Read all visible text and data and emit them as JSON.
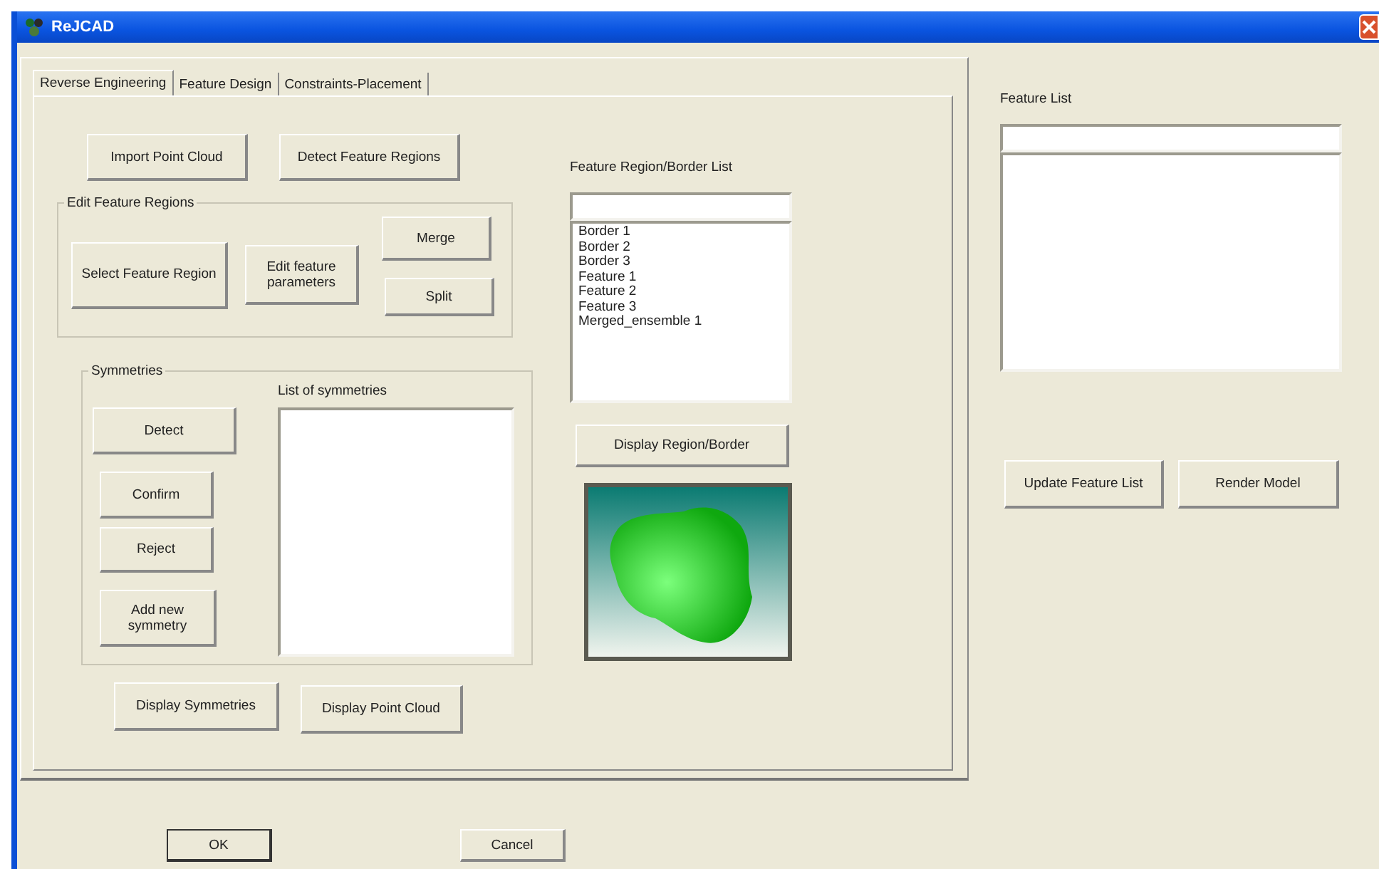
{
  "window": {
    "title": "ReJCAD"
  },
  "tabs": [
    {
      "label": "Reverse Engineering",
      "selected": true
    },
    {
      "label": "Feature Design",
      "selected": false
    },
    {
      "label": "Constraints-Placement",
      "selected": false
    }
  ],
  "top_buttons": [
    "Import Point Cloud",
    "Detect Feature Regions"
  ],
  "edit_feature_regions": {
    "title": "Edit Feature Regions",
    "buttons": [
      "Select Feature Region",
      "Edit feature parameters",
      "Merge",
      "Split"
    ]
  },
  "symmetries": {
    "title": "Symmetries",
    "buttons": [
      "Detect",
      "Confirm",
      "Reject",
      "Add new symmetry"
    ],
    "list_label": "List of symmetries"
  },
  "bottom_buttons": [
    "Display Symmetries",
    "Display Point Cloud"
  ],
  "region_list": {
    "label": "Feature Region/Border List",
    "items": [
      "Border 1",
      "Border 2",
      "Border 3",
      "Feature 1",
      "Feature 2",
      "Feature 3",
      "Merged_ensemble 1"
    ],
    "button": "Display Region/Border"
  },
  "feature_list": {
    "label": "Feature List",
    "buttons": [
      "Update Feature List",
      "Render Model"
    ]
  },
  "dialog_buttons": [
    "OK",
    "Cancel"
  ]
}
